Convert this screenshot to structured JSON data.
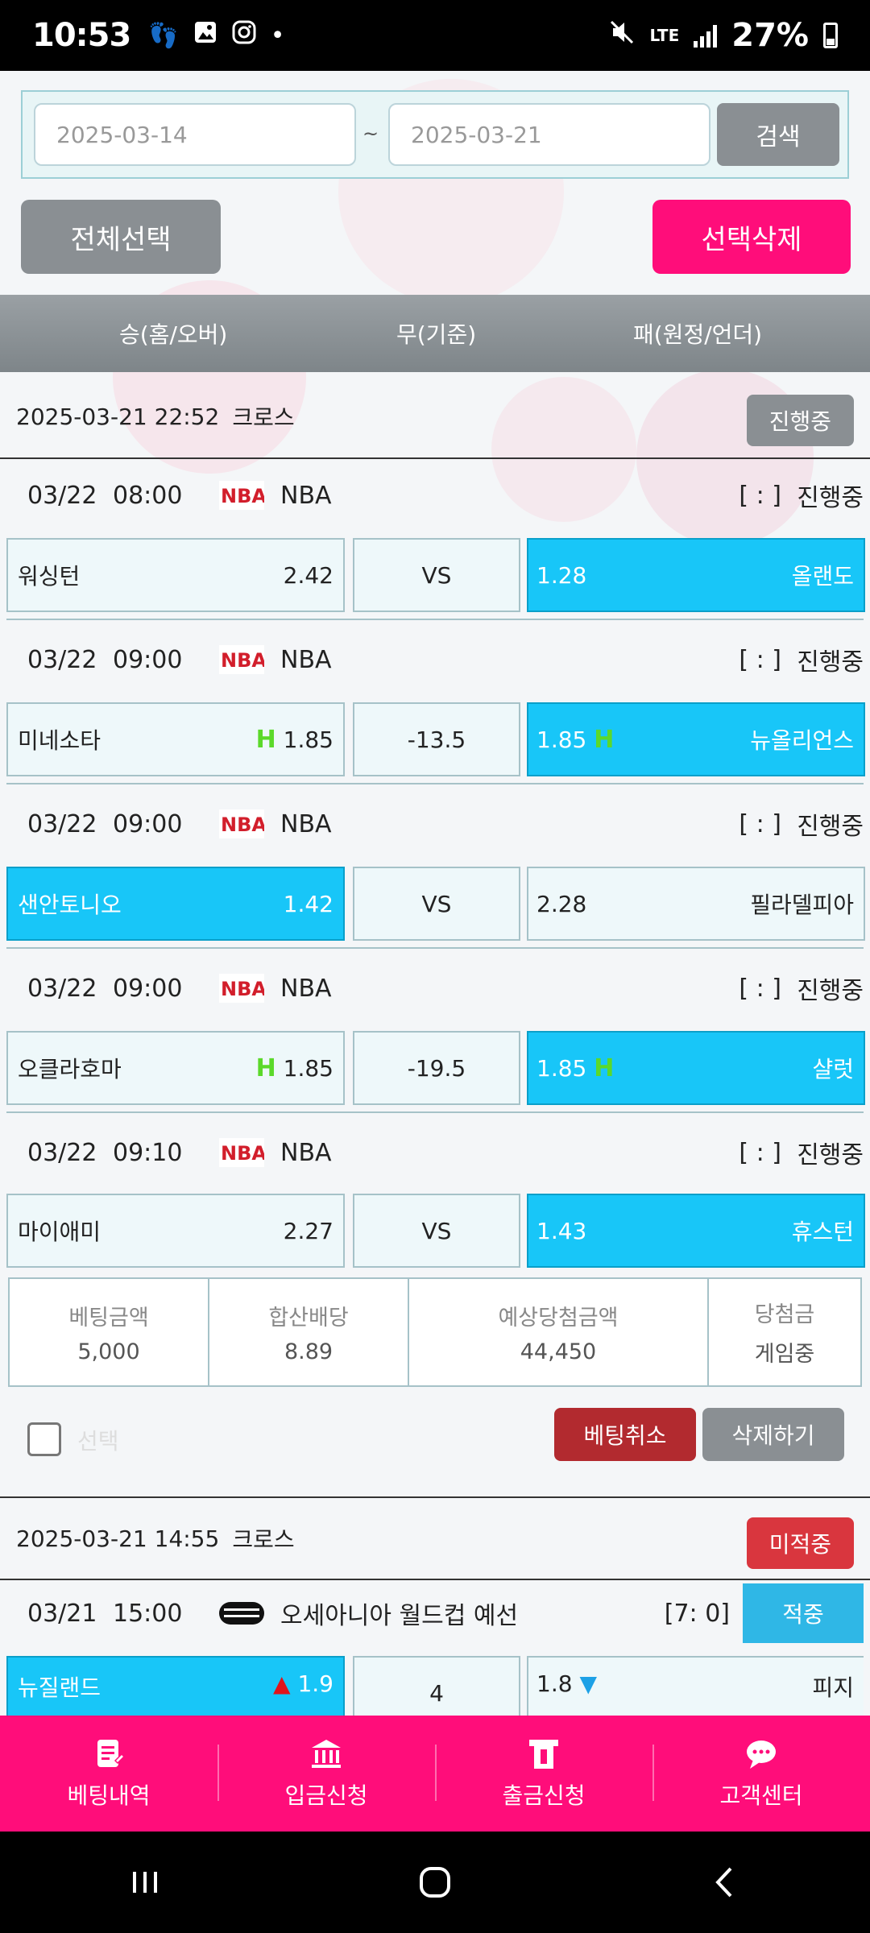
{
  "status_bar": {
    "time": "10:53",
    "battery": "27%",
    "network": "LTE"
  },
  "search": {
    "start_date": "2025-03-14",
    "end_date": "2025-03-21",
    "separator": "~",
    "button": "검색"
  },
  "actions": {
    "select_all": "전체선택",
    "delete_selected": "선택삭제"
  },
  "columns": {
    "home": "승(홈/오버)",
    "draw": "무(기준)",
    "away": "패(원정/언더)"
  },
  "bet1": {
    "datetime": "2025-03-21 22:52",
    "type": "크로스",
    "status": "진행중",
    "matches": [
      {
        "date": "03/22",
        "time": "08:00",
        "league": "NBA",
        "score": "[ : ]",
        "state": "진행중",
        "home": "워싱턴",
        "home_odd": "2.42",
        "mid": "VS",
        "away_odd": "1.28",
        "away": "올랜도"
      },
      {
        "date": "03/22",
        "time": "09:00",
        "league": "NBA",
        "score": "[ : ]",
        "state": "진행중",
        "home": "미네소타",
        "home_odd": "1.85",
        "mid": "-13.5",
        "away_odd": "1.85",
        "away": "뉴올리언스"
      },
      {
        "date": "03/22",
        "time": "09:00",
        "league": "NBA",
        "score": "[ : ]",
        "state": "진행중",
        "home": "샌안토니오",
        "home_odd": "1.42",
        "mid": "VS",
        "away_odd": "2.28",
        "away": "필라델피아"
      },
      {
        "date": "03/22",
        "time": "09:00",
        "league": "NBA",
        "score": "[ : ]",
        "state": "진행중",
        "home": "오클라호마",
        "home_odd": "1.85",
        "mid": "-19.5",
        "away_odd": "1.85",
        "away": "샬럿"
      },
      {
        "date": "03/22",
        "time": "09:10",
        "league": "NBA",
        "score": "[ : ]",
        "state": "진행중",
        "home": "마이애미",
        "home_odd": "2.27",
        "mid": "VS",
        "away_odd": "1.43",
        "away": "휴스턴"
      }
    ],
    "summary": {
      "amount_label": "베팅금액",
      "amount": "5,000",
      "odds_label": "합산배당",
      "odds": "8.89",
      "expected_label": "예상당첨금액",
      "expected": "44,450",
      "prize_label": "당첨금",
      "prize": "게임중"
    },
    "check_label": "선택",
    "cancel": "베팅취소",
    "delete": "삭제하기"
  },
  "bet2": {
    "datetime": "2025-03-21 14:55",
    "type": "크로스",
    "status": "미적중",
    "match": {
      "date": "03/21",
      "time": "15:00",
      "league": "오세아니아 월드컵 예선",
      "score": "[7: 0]",
      "state": "적중",
      "home": "뉴질랜드",
      "home_odd": "1.9",
      "mid": "4",
      "away_odd": "1.8",
      "away": "피지"
    }
  },
  "bottom_nav": {
    "history": "베팅내역",
    "deposit": "입금신청",
    "withdraw": "출금신청",
    "support": "고객센터"
  },
  "colors": {
    "accent_pink": "#ff0d7a",
    "selected_cyan": "#18c6f8",
    "neutral_gray": "#8a8f93",
    "lost_red": "#d9363e",
    "won_blue": "#2fb7e6"
  }
}
